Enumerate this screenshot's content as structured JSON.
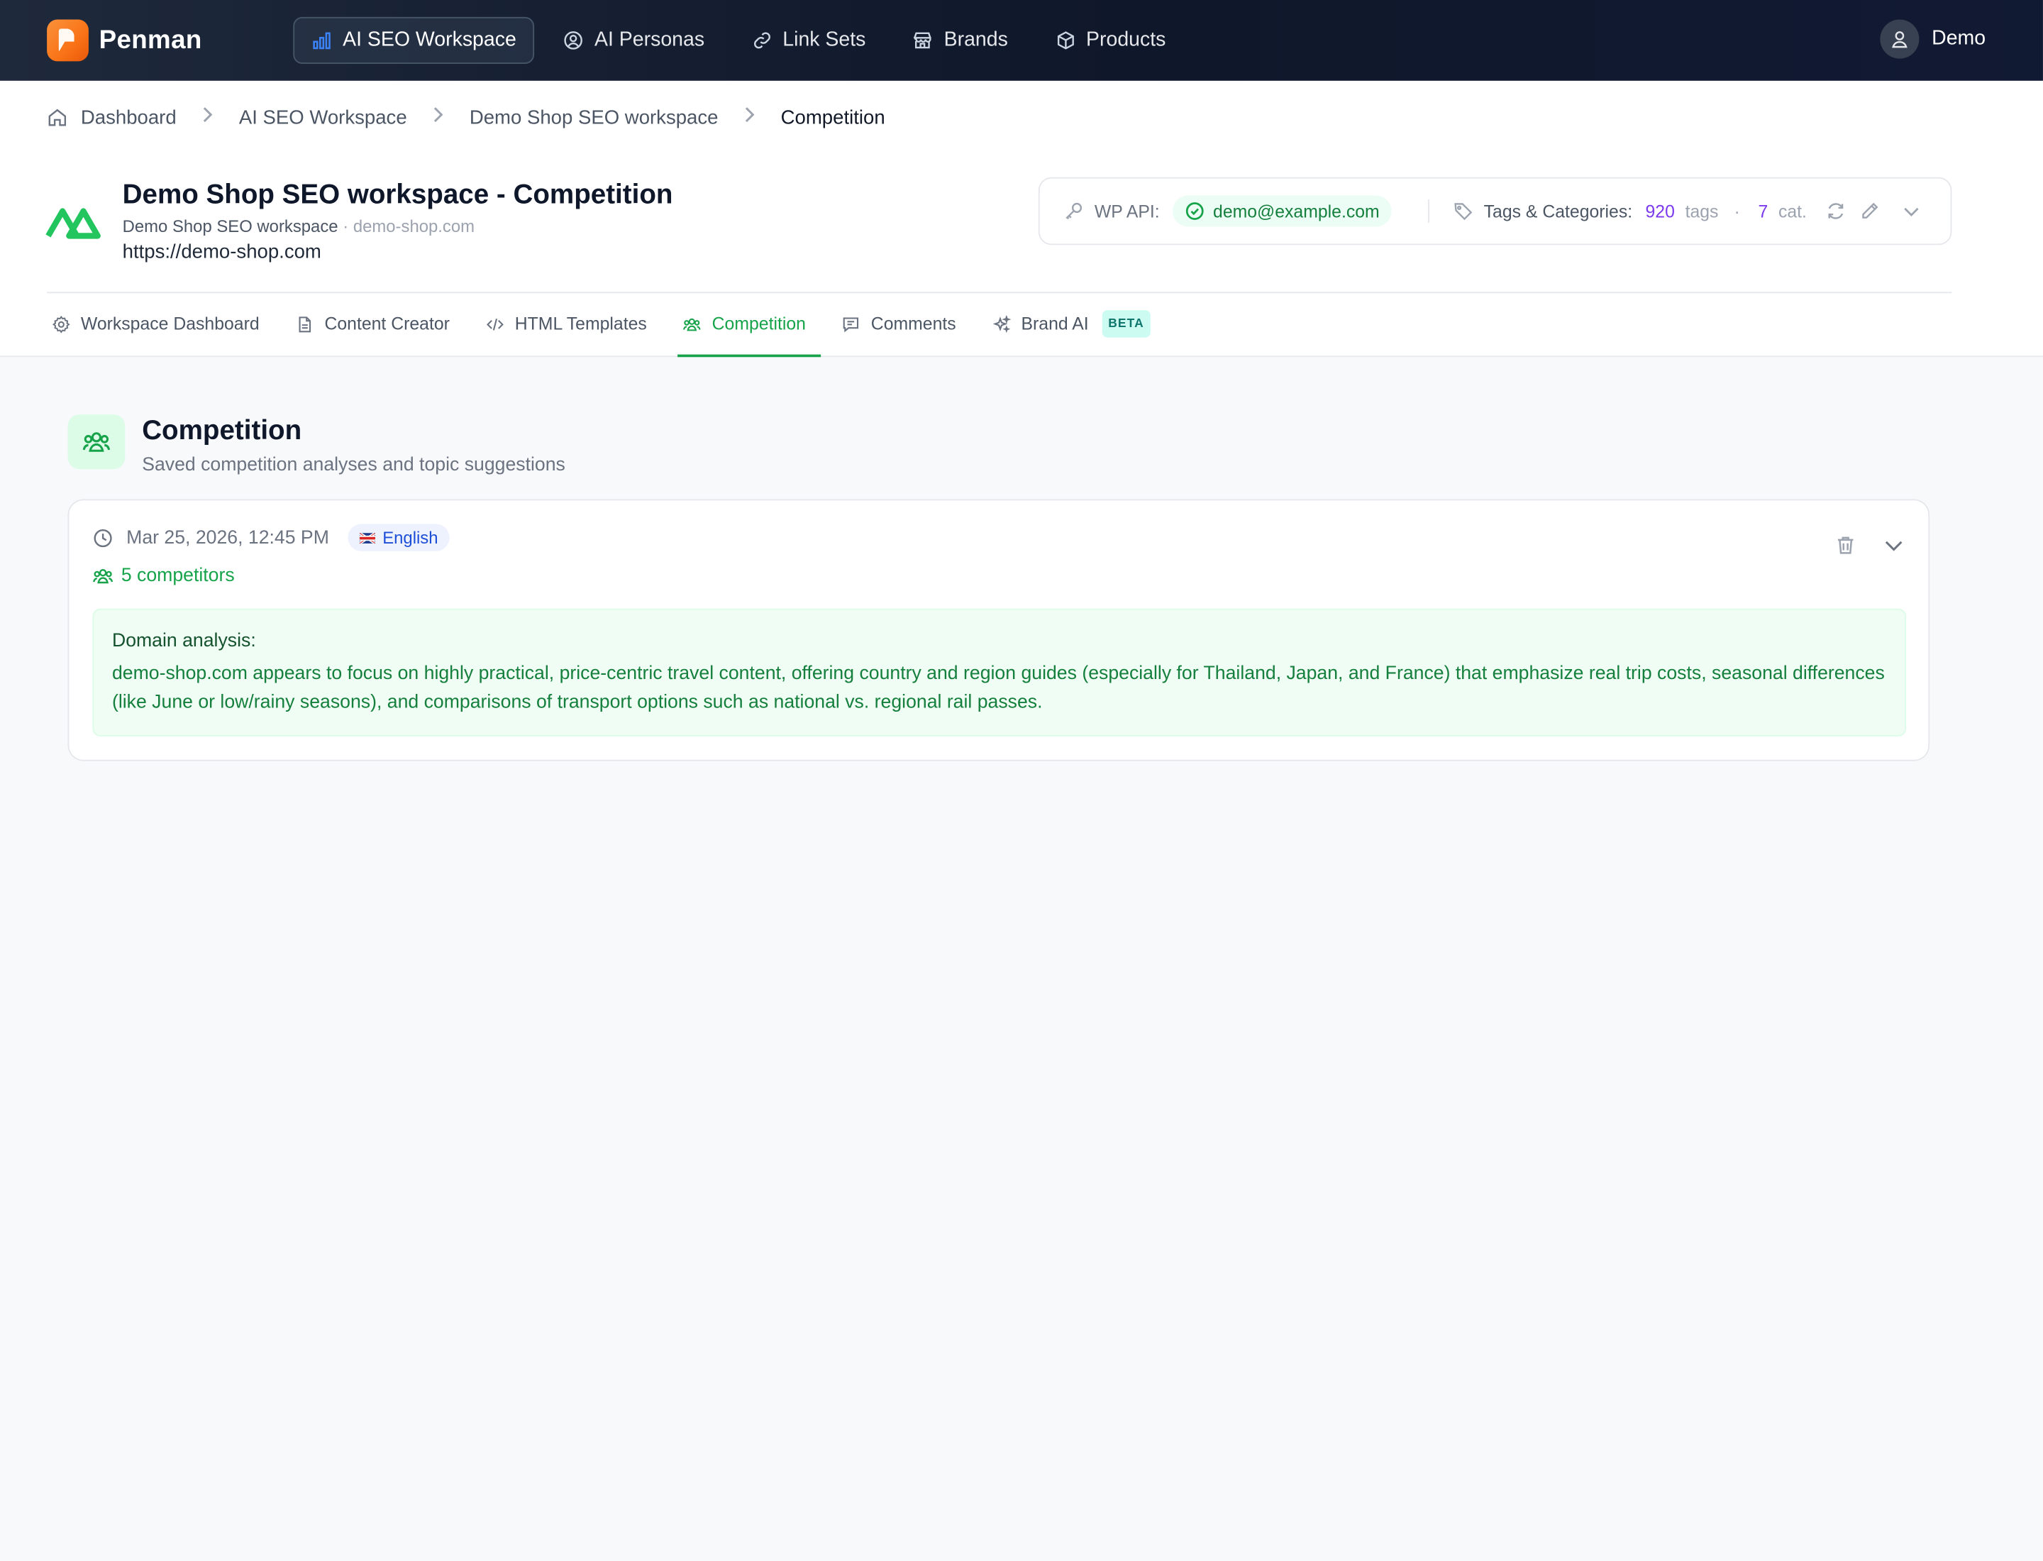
{
  "app": {
    "name": "Penman",
    "user": "Demo"
  },
  "nav": [
    {
      "label": "AI SEO Workspace",
      "icon": "bar-chart-icon",
      "active": true
    },
    {
      "label": "AI Personas",
      "icon": "user-circle-icon",
      "active": false
    },
    {
      "label": "Link Sets",
      "icon": "link-icon",
      "active": false
    },
    {
      "label": "Brands",
      "icon": "store-icon",
      "active": false
    },
    {
      "label": "Products",
      "icon": "box-icon",
      "active": false
    }
  ],
  "breadcrumb": [
    "Dashboard",
    "AI SEO Workspace",
    "Demo Shop SEO workspace",
    "Competition"
  ],
  "workspace": {
    "title": "Demo Shop SEO workspace - Competition",
    "name": "Demo Shop SEO workspace",
    "domain": "demo-shop.com",
    "url": "https://demo-shop.com"
  },
  "wp": {
    "api_label": "WP API:",
    "account": "demo@example.com",
    "tags_label": "Tags & Categories:",
    "tags_count": "920",
    "tags_unit": "tags",
    "separator": "·",
    "cat_count": "7",
    "cat_unit": "cat."
  },
  "tabs": [
    {
      "label": "Workspace Dashboard",
      "icon": "gear-icon"
    },
    {
      "label": "Content Creator",
      "icon": "document-icon"
    },
    {
      "label": "HTML Templates",
      "icon": "code-icon"
    },
    {
      "label": "Competition",
      "icon": "users-icon",
      "active": true
    },
    {
      "label": "Comments",
      "icon": "comment-icon"
    },
    {
      "label": "Brand AI",
      "icon": "sparkles-icon",
      "badge": "BETA"
    }
  ],
  "page": {
    "title": "Competition",
    "subtitle": "Saved competition analyses and topic suggestions"
  },
  "analysis": {
    "timestamp": "Mar 25, 2026, 12:45 PM",
    "language": "English",
    "competitors": "5 competitors",
    "domain_title": "Domain analysis:",
    "domain_text": "demo-shop.com appears to focus on highly practical, price-centric travel content, offering country and region guides (especially for Thailand, Japan, and France) that emphasize real trip costs, seasonal differences (like June or low/rainy seasons), and comparisons of transport options such as national vs. regional rail passes."
  },
  "colors": {
    "accent": "#16a34a",
    "nav_bg": "#0f172a",
    "link": "#7c3aed"
  }
}
